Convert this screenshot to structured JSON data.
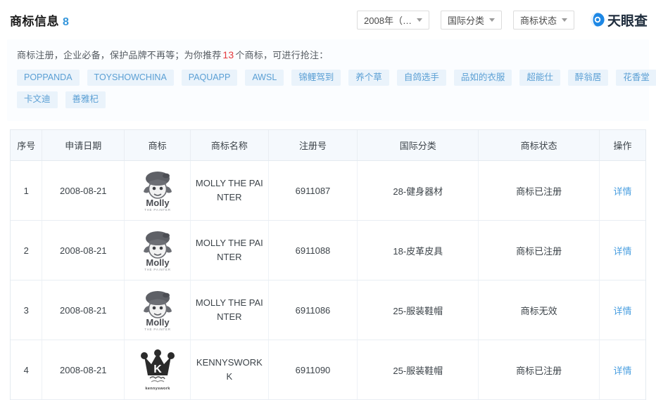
{
  "header": {
    "title": "商标信息",
    "count": "8",
    "dropdowns": [
      {
        "label": "2008年（…"
      },
      {
        "label": "国际分类"
      },
      {
        "label": "商标状态"
      }
    ],
    "brand": "天眼查"
  },
  "promo": {
    "text_before": "商标注册，企业必备，保护品牌不再等；为你推荐",
    "count": "13",
    "text_after": "个商标，可进行抢注：",
    "tag_rows": [
      [
        "POPPANDA",
        "TOYSHOWCHINA",
        "PAQUAPP",
        "AWSL",
        "锦鲤驾到",
        "养个草",
        "自鸽选手",
        "品如的衣服",
        "超能仕",
        "醉翁居",
        "花香堂"
      ],
      [
        "卡文迪",
        "善雅杞"
      ]
    ]
  },
  "table": {
    "columns": [
      "序号",
      "申请日期",
      "商标",
      "商标名称",
      "注册号",
      "国际分类",
      "商标状态",
      "操作"
    ],
    "action_label": "详情",
    "rows": [
      {
        "index": "1",
        "apply_date": "2008-08-21",
        "logo": "molly-trademark-logo",
        "logo_caption": "Molly",
        "logo_subcaption": "THE PAINTER",
        "name": "MOLLY THE PAINTER",
        "reg_no": "6911087",
        "class": "28-健身器材",
        "status": "商标已注册",
        "action": "详情"
      },
      {
        "index": "2",
        "apply_date": "2008-08-21",
        "logo": "molly-trademark-logo",
        "logo_caption": "Molly",
        "logo_subcaption": "THE PAINTER",
        "name": "MOLLY THE PAINTER",
        "reg_no": "6911088",
        "class": "18-皮革皮具",
        "status": "商标已注册",
        "action": "详情"
      },
      {
        "index": "3",
        "apply_date": "2008-08-21",
        "logo": "molly-trademark-logo",
        "logo_caption": "Molly",
        "logo_subcaption": "THE PAINTER",
        "name": "MOLLY THE PAINTER",
        "reg_no": "6911086",
        "class": "25-服装鞋帽",
        "status": "商标无效",
        "action": "详情"
      },
      {
        "index": "4",
        "apply_date": "2008-08-21",
        "logo": "kennyswork-crown-logo",
        "logo_caption": "K",
        "logo_subcaption": "kennyswork",
        "name": "KENNYSWORKK",
        "reg_no": "6911090",
        "class": "25-服装鞋帽",
        "status": "商标已注册",
        "action": "详情"
      }
    ]
  },
  "colors": {
    "accent_blue": "#3596db",
    "link_blue": "#4a9fe0",
    "tag_bg": "#eaf3fb",
    "tag_text": "#5a9fd4",
    "promo_red": "#e4393c",
    "header_bg": "#f5f9fd"
  }
}
